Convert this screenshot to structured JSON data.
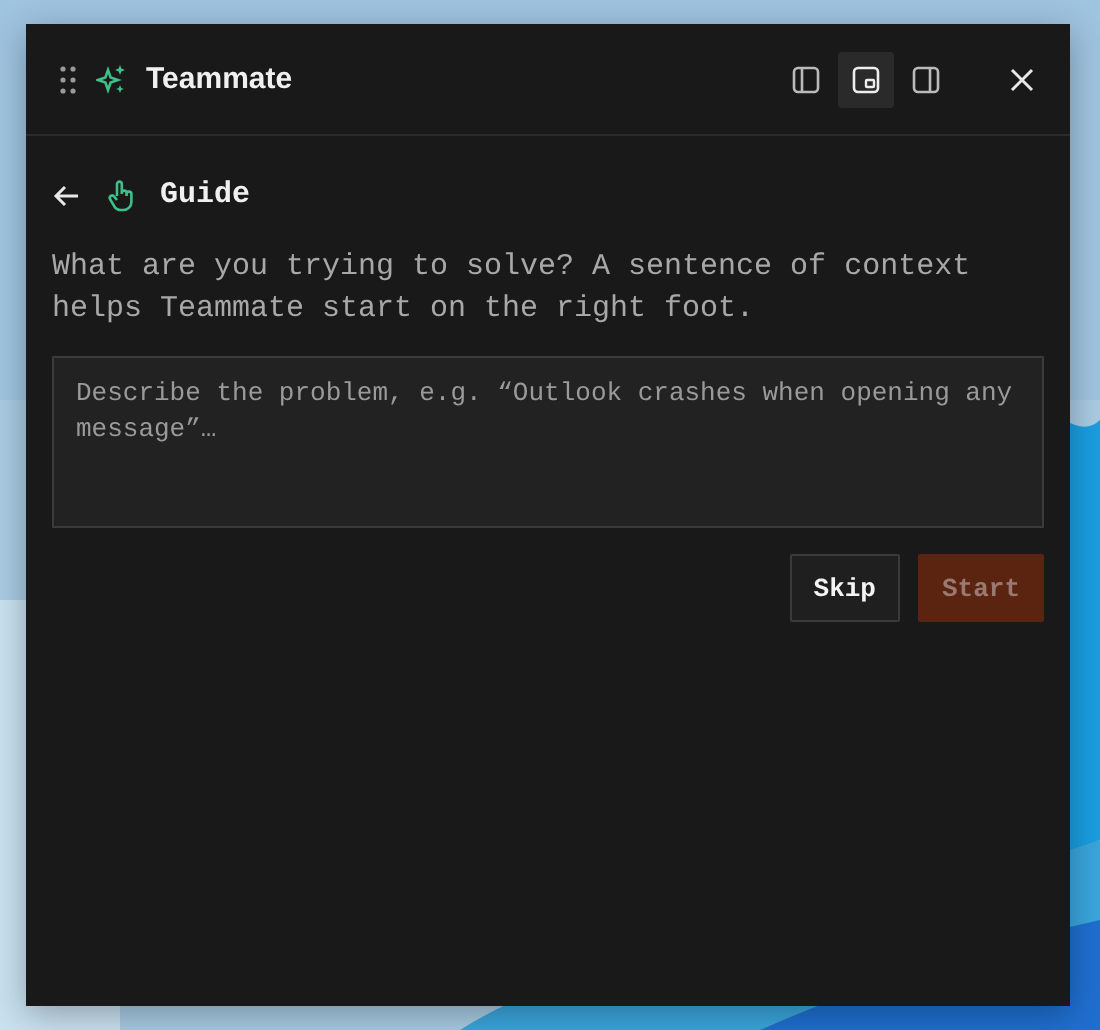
{
  "window": {
    "title": "Teammate",
    "dock_options": [
      {
        "kind": "left",
        "selected": false
      },
      {
        "kind": "float",
        "selected": true
      },
      {
        "kind": "right",
        "selected": false
      }
    ]
  },
  "page": {
    "title": "Guide",
    "prompt": "What are you trying to solve? A sentence of context helps Teammate start on the right foot.",
    "field": {
      "placeholder": "Describe the problem, e.g. “Outlook crashes when opening any message”…"
    }
  },
  "buttons": [
    {
      "kind": "secondary",
      "label": "Skip",
      "disabled": false
    },
    {
      "kind": "primary",
      "label": "Start",
      "disabled": true
    }
  ]
}
